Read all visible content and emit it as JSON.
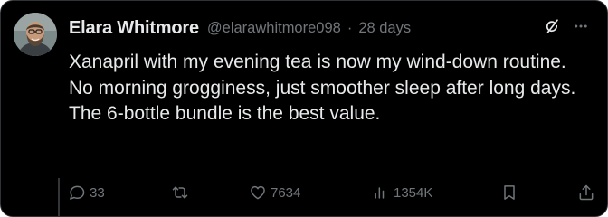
{
  "user": {
    "name": "Elara Whitmore",
    "handle": "@elarawhitmore098",
    "separator": "·",
    "time": "28 days"
  },
  "tweet": {
    "text": "Xanapril with my evening tea is now my wind-down routine. No morning grogginess, just smoother sleep after long days. The 6-bottle bundle is the best value."
  },
  "actions": {
    "replies": "33",
    "likes": "7634",
    "views": "1354K"
  },
  "icons": {
    "top": [
      "grok-icon",
      "more-icon"
    ],
    "actions": [
      "reply-icon",
      "retweet-icon",
      "like-icon",
      "views-icon",
      "bookmark-icon",
      "share-icon"
    ]
  },
  "colors": {
    "background": "#000000",
    "text": "#e7e9ea",
    "muted": "#71767b"
  }
}
